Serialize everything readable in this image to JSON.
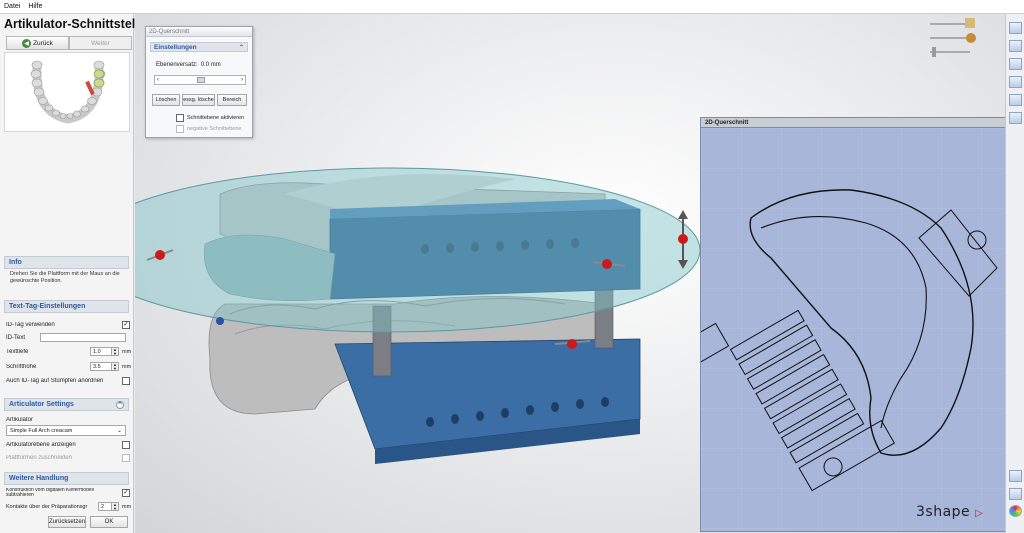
{
  "menu": {
    "file": "Datei",
    "help": "Hilfe"
  },
  "left_panel": {
    "title": "Artikulator-Schnittstelle",
    "back_label": "Zurück",
    "next_label": "Weiter",
    "info": {
      "header": "Info",
      "text": "Drehen Sie die Plattform mit der Maus an die gewünschte Position."
    },
    "text_tag": {
      "header": "Text-Tag-Einstellungen",
      "use_id_tag": "ID-Tag verwenden",
      "use_id_tag_checked": true,
      "id_text_label": "ID-Text",
      "id_text_value": "",
      "text_depth_label": "Texttiefe",
      "text_depth_value": "1.0",
      "font_height_label": "Schrifthöhe",
      "font_height_value": "3.5",
      "unit": "mm",
      "also_on_stumps": "Auch ID-Tag auf Stümpfen anordnen",
      "also_on_stumps_checked": false
    },
    "articulator": {
      "header": "Articulator Settings",
      "label": "Artikulator",
      "selected": "Simple Full Arch creacam",
      "show_plane": "Artikulatorebene anzeigen",
      "show_plane_checked": false,
      "trim_platforms": "Plattformen zuschneiden",
      "trim_platforms_checked": false
    },
    "further": {
      "header": "Weitere Handlung",
      "subtract": "Konstruktion vom digitalen Kiefermodell subtrahieren",
      "subtract_checked": true,
      "contacts_label": "Kontakte über der Präparationsgr",
      "contacts_value": "2",
      "contacts_unit": "mm"
    },
    "reset_label": "Zurücksetzen",
    "ok_label": "OK"
  },
  "cross_section_panel": {
    "title": "2D-Querschnitt",
    "settings_header": "Einstellungen",
    "offset_label": "Ebenenversatz:",
    "offset_value": "0.0 mm",
    "delete_label": "Löschen",
    "delete_all_label": "essg. lösche",
    "range_label": "Bereich",
    "activate_label": "Schnittebene aktivieren",
    "activate_checked": false,
    "negative_label": "negative Schnittebene",
    "negative_checked": false
  },
  "cross_section_view": {
    "title": "2D-Querschnitt"
  },
  "brand": {
    "logo_text": "3shape"
  },
  "colors": {
    "platform_blue": "#2e5f93",
    "plane_teal": "#7fc3c7",
    "section_bg": "#a8b6da",
    "accent_red": "#cc1a1a",
    "header_blue": "#2d5aa0"
  }
}
